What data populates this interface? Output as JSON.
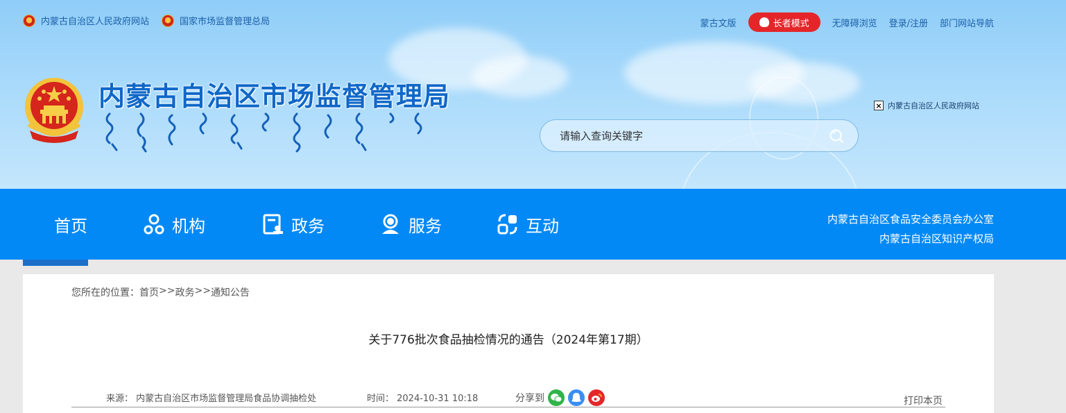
{
  "top_left_links": [
    {
      "label": "内蒙古自治区人民政府网站"
    },
    {
      "label": "国家市场监督管理总局"
    }
  ],
  "top_right_links": {
    "mongolian": "蒙古文版",
    "elder_mode": "长者模式",
    "accessible": "无障碍浏览",
    "login": "登录/注册",
    "dept_nav": "部门网站导航"
  },
  "site_title": "内蒙古自治区市场监督管理局",
  "gov_link": "内蒙古自治区人民政府网站",
  "search": {
    "placeholder": "请输入查询关键字"
  },
  "nav": {
    "items": [
      {
        "label": "首页"
      },
      {
        "label": "机构"
      },
      {
        "label": "政务"
      },
      {
        "label": "服务"
      },
      {
        "label": "互动"
      }
    ],
    "right_links": [
      "内蒙古自治区食品安全委员会办公室",
      "内蒙古自治区知识产权局"
    ]
  },
  "breadcrumb": {
    "prefix": "您所在的位置：",
    "home": "首页",
    "sep1": ">>",
    "gov": "政务",
    "sep2": ">>",
    "notice": "通知公告"
  },
  "article": {
    "title": "关于776批次食品抽检情况的通告（2024年第17期）",
    "source": "来源： 内蒙古自治区市场监督管理局食品协调抽检处",
    "time": "时间： 2024-10-31 10:18",
    "share_label": "分享到",
    "print_label": "打印本页"
  },
  "colors": {
    "nav_bg": "#0389f6",
    "title": "#0f67c8",
    "elder": "#e4262a",
    "wechat": "#2fb44a",
    "qq": "#3a8ef2",
    "weibo": "#e4262a"
  },
  "icons": [
    "emblem-icon",
    "broken-image-icon",
    "search-icon",
    "org-icon",
    "gov-affairs-icon",
    "service-icon",
    "interact-icon",
    "wechat-icon",
    "qq-icon",
    "weibo-icon"
  ]
}
